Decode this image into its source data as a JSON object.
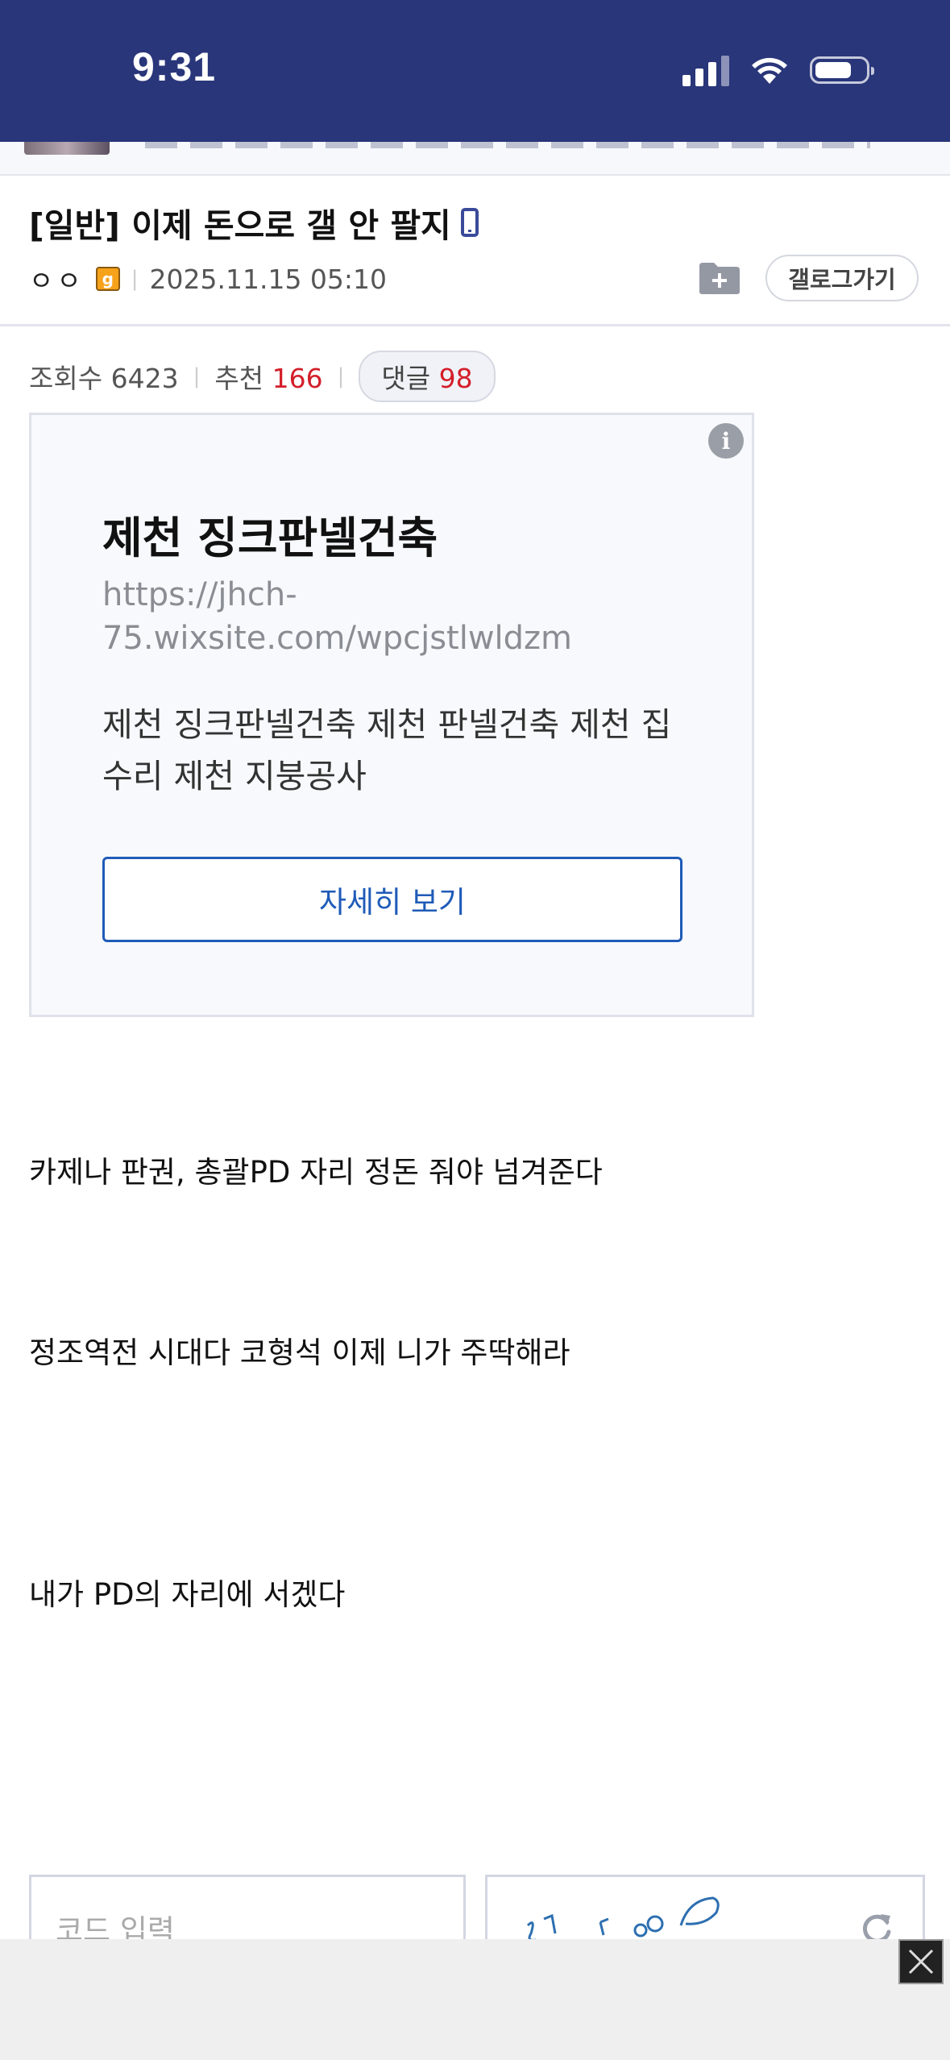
{
  "status_bar": {
    "time": "9:31"
  },
  "post": {
    "title": "[일반] 이제 돈으로 갤 안 팔지",
    "author": "ㅇㅇ",
    "gonic_badge": "g",
    "date": "2025.11.15 05:10",
    "gallog_label": "갤로그가기",
    "views_label": "조회수",
    "views": "6423",
    "recommend_label": "추천",
    "recommend": "166",
    "comments_label": "댓글",
    "comments": "98"
  },
  "ad": {
    "info": "i",
    "title": "제천 징크판넬건축",
    "url": "https://jhch-75.wixsite.com/wpcjstlwldzm",
    "description": "제천 징크판넬건축 제천 판넬건축 제천 집수리 제천 지붕공사",
    "button": "자세히 보기"
  },
  "body": {
    "line1": "카제나 판권, 총괄PD 자리 정돈 줘야 넘겨준다",
    "line2": "정조역전 시대다 코형석 이제 니가 주딱해라",
    "line3": " 내가 PD의 자리에 서겠다"
  },
  "captcha": {
    "placeholder": "코드 입력"
  },
  "colors": {
    "header_bg": "#29367a",
    "accent_red": "#d31f2a",
    "ad_button": "#1f5bb8"
  }
}
